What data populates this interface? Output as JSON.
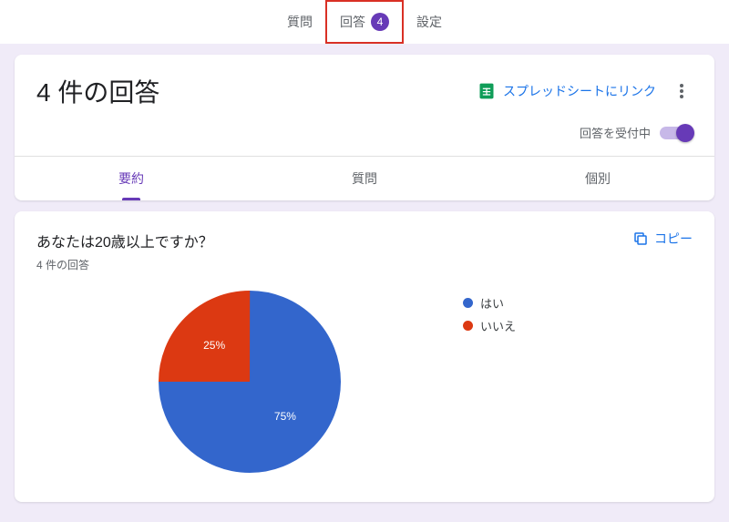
{
  "top_tabs": {
    "questions": "質問",
    "responses": "回答",
    "responses_badge": "4",
    "settings": "設定"
  },
  "summary": {
    "title": "4 件の回答",
    "link_to_sheets": "スプレッドシートにリンク",
    "accepting": "回答を受付中"
  },
  "inner_tabs": {
    "summary": "要約",
    "question": "質問",
    "individual": "個別"
  },
  "question": {
    "title": "あなたは20歳以上ですか？",
    "count": "4 件の回答",
    "copy": "コピー"
  },
  "chart_data": {
    "type": "pie",
    "title": "あなたは20歳以上ですか？",
    "categories": [
      "はい",
      "いいえ"
    ],
    "values": [
      75,
      25
    ],
    "labels": [
      "75%",
      "25%"
    ],
    "colors": [
      "#3366cc",
      "#dc3912"
    ]
  }
}
